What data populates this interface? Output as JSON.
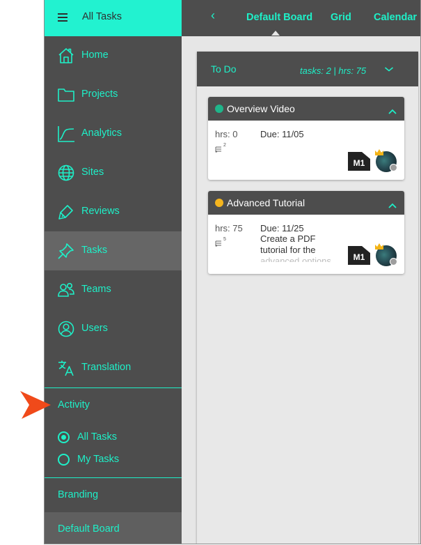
{
  "sidebar": {
    "header_title": "All Tasks",
    "items": [
      {
        "label": "Home",
        "icon": "home-icon"
      },
      {
        "label": "Projects",
        "icon": "folder-icon"
      },
      {
        "label": "Analytics",
        "icon": "analytics-icon"
      },
      {
        "label": "Sites",
        "icon": "globe-icon"
      },
      {
        "label": "Reviews",
        "icon": "highlighter-icon"
      },
      {
        "label": "Tasks",
        "icon": "pin-icon",
        "active": true
      },
      {
        "label": "Teams",
        "icon": "people-icon"
      },
      {
        "label": "Users",
        "icon": "user-circle-icon"
      },
      {
        "label": "Translation",
        "icon": "translate-icon"
      }
    ],
    "activity_label": "Activity",
    "radio_options": [
      {
        "label": "All Tasks",
        "selected": true
      },
      {
        "label": "My Tasks",
        "selected": false
      }
    ],
    "branding_label": "Branding",
    "default_board_label": "Default Board"
  },
  "topbar": {
    "back_glyph": "‹",
    "tabs": [
      {
        "label": "Default Board",
        "active": true
      },
      {
        "label": "Grid"
      },
      {
        "label": "Calendar"
      }
    ]
  },
  "board": {
    "column": {
      "title": "To Do",
      "stats": "tasks: 2 | hrs: 75"
    },
    "cards": [
      {
        "title": "Overview Video",
        "status_color": "#1fb58a",
        "hrs": "hrs: 0",
        "due": "Due: 11/05",
        "subtask_count": "2",
        "badge": "M1",
        "description": ""
      },
      {
        "title": "Advanced Tutorial",
        "status_color": "#f5b51e",
        "hrs": "hrs: 75",
        "due": "Due: 11/25",
        "subtask_count": "5",
        "badge": "M1",
        "description_lines": [
          "Create a PDF",
          "tutorial for the",
          "advanced options"
        ]
      }
    ]
  },
  "colors": {
    "accent": "#1ef0c8",
    "header_accent": "#22f2d0",
    "sidebar_bg": "#4d4d4d",
    "pointer": "#f04a1a"
  }
}
